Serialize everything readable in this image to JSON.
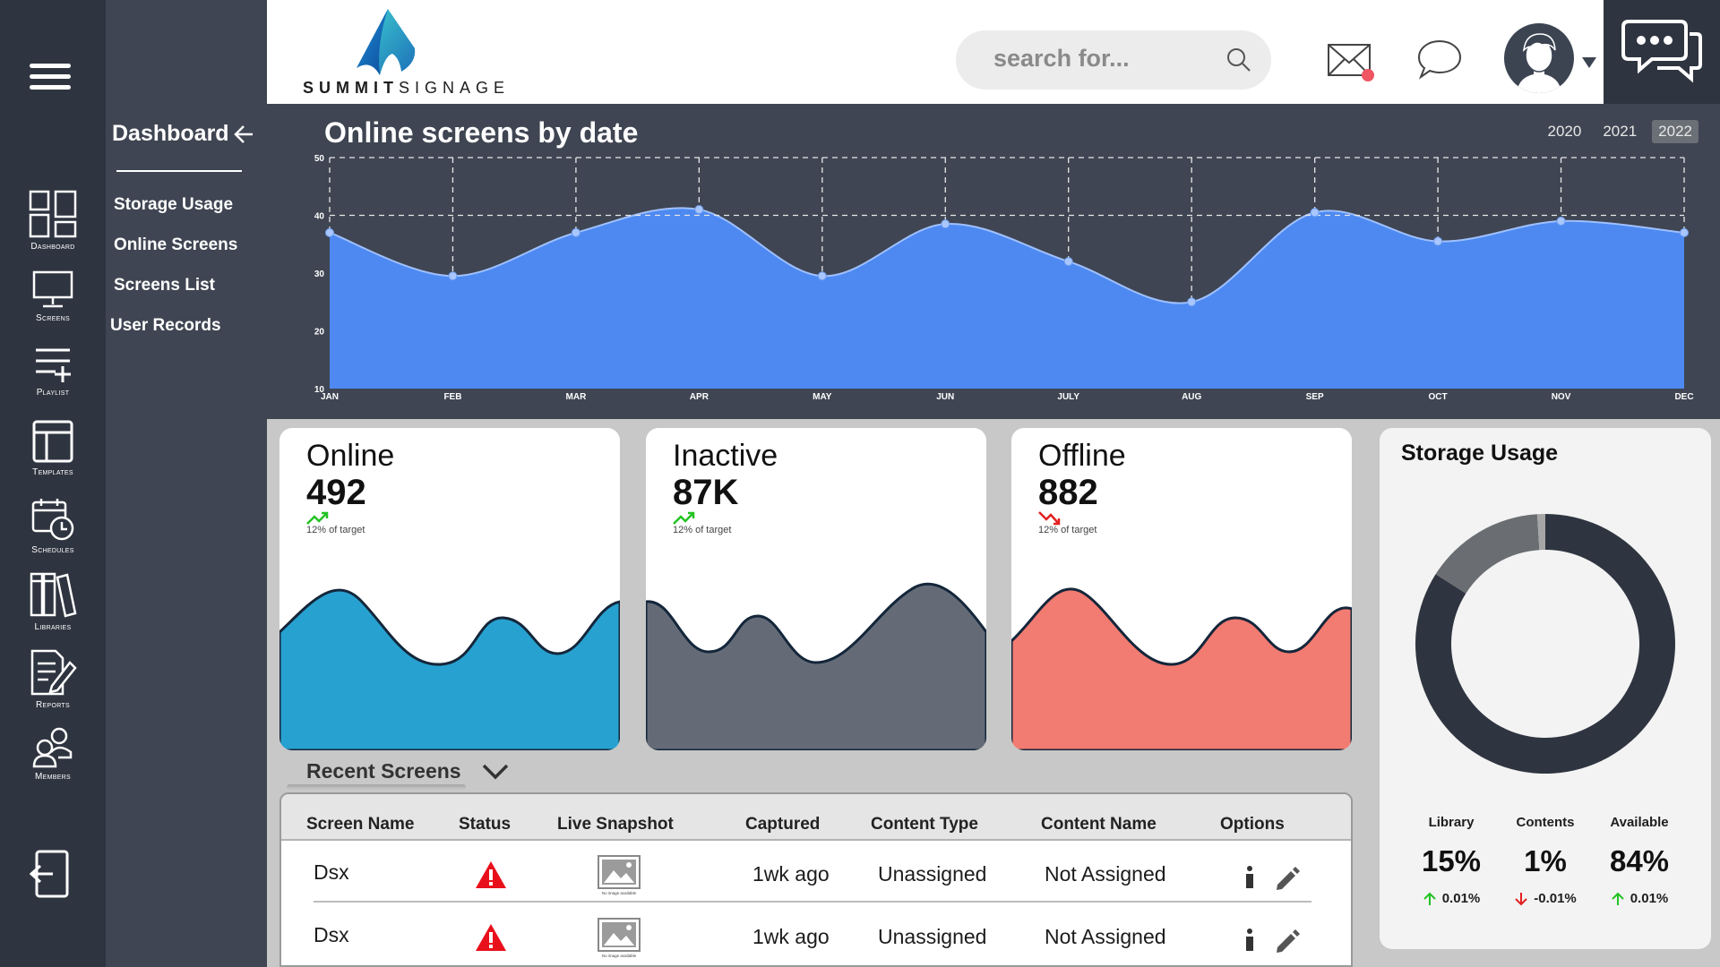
{
  "app": {
    "logo_part1": "SUMMIT",
    "logo_part2": "SIGNAGE",
    "search_placeholder": "search for..."
  },
  "rail": {
    "items": [
      {
        "label": "Dashboard",
        "icon": "dashboard-grid-icon"
      },
      {
        "label": "Screens",
        "icon": "monitor-icon"
      },
      {
        "label": "Playlist",
        "icon": "playlist-add-icon"
      },
      {
        "label": "Templates",
        "icon": "template-layout-icon"
      },
      {
        "label": "Schedules",
        "icon": "calendar-clock-icon"
      },
      {
        "label": "Libraries",
        "icon": "books-icon"
      },
      {
        "label": "Reports",
        "icon": "report-edit-icon"
      },
      {
        "label": "Members",
        "icon": "people-icon"
      }
    ],
    "logout_icon": "logout-icon"
  },
  "submenu": {
    "title": "Dashboard",
    "items": [
      "Storage Usage",
      "Online Screens",
      "Screens List",
      "User Records"
    ]
  },
  "chart": {
    "title": "Online screens by date",
    "years": [
      "2020",
      "2021",
      "2022"
    ],
    "active_year": "2022",
    "fill_color": "#4d89f1"
  },
  "chart_data": {
    "type": "area",
    "title": "Online screens by date",
    "categories": [
      "JAN",
      "FEB",
      "MAR",
      "APR",
      "MAY",
      "JUN",
      "JULY",
      "AUG",
      "SEP",
      "OCT",
      "NOV",
      "DEC"
    ],
    "series": [
      {
        "values": [
          37,
          29.5,
          37,
          41,
          29.5,
          38.5,
          32,
          25,
          40.5,
          35.5,
          39,
          37
        ]
      }
    ],
    "yticks": [
      10,
      20,
      30,
      40,
      50
    ],
    "ylim": [
      10,
      50
    ],
    "grid": true,
    "xlabel": "",
    "ylabel": ""
  },
  "stats": [
    {
      "label": "Online",
      "value": "492",
      "sub": "12% of target",
      "trend": "up",
      "color": "#27a1d0"
    },
    {
      "label": "Inactive",
      "value": "87K",
      "sub": "12% of target",
      "trend": "up",
      "color": "#646b77"
    },
    {
      "label": "Offline",
      "value": "882",
      "sub": "12% of target",
      "trend": "down",
      "color": "#f27b72"
    }
  ],
  "storage": {
    "title": "Storage Usage",
    "columns": [
      {
        "label": "Library",
        "value": "15%",
        "delta": "0.01%",
        "direction": "up"
      },
      {
        "label": "Contents",
        "value": "1%",
        "delta": "-0.01%",
        "direction": "down"
      },
      {
        "label": "Available",
        "value": "84%",
        "delta": "0.01%",
        "direction": "up"
      }
    ],
    "donut_colors": {
      "main": "#2f3540",
      "secondary": "#6a6d72",
      "tertiary": "#a6a6a6"
    }
  },
  "recent": {
    "title": "Recent Screens",
    "columns": [
      "Screen Name",
      "Status",
      "Live Snapshot",
      "Captured",
      "Content Type",
      "Content Name",
      "Options"
    ],
    "rows": [
      {
        "name": "Dsx",
        "status": "warning",
        "snapshot_caption": "No image available",
        "captured": "1wk ago",
        "content_type": "Unassigned",
        "content_name": "Not Assigned"
      },
      {
        "name": "Dsx",
        "status": "warning",
        "snapshot_caption": "No image available",
        "captured": "1wk ago",
        "content_type": "Unassigned",
        "content_name": "Not Assigned"
      }
    ]
  }
}
